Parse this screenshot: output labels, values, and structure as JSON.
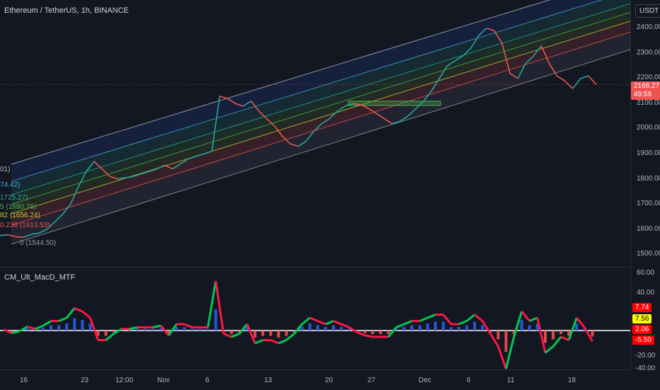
{
  "main": {
    "title": "Ethereum / TetherUS, 1h, BINANCE",
    "currency": "USDT",
    "last_price": "2166.27",
    "countdown": "49:59",
    "price_ticks": [
      "2400.00",
      "2300.00",
      "2200.00",
      "2100.00",
      "2000.00",
      "1900.00",
      "1800.00",
      "1700.00",
      "1600.00",
      "1500.00"
    ],
    "fib_labels": [
      {
        "text": "01)",
        "color": "#b2b5be"
      },
      {
        "text": "74.42)",
        "color": "#4aa3d8"
      },
      {
        "text": "1725.27)",
        "color": "#26a69a"
      },
      {
        "text": "5 (1690.76)",
        "color": "#4caf50"
      },
      {
        "text": "82 (1656.24)",
        "color": "#c0ca33"
      },
      {
        "text": "0.236 (1613.53)",
        "color": "#ef5350"
      },
      {
        "text": "0 (1544.50)",
        "color": "#9598a1"
      }
    ]
  },
  "indicator": {
    "title": "CM_Ult_MacD_MTF",
    "ticks": [
      "60.00",
      "40.00",
      "-20.00",
      "-40.00"
    ],
    "badges": [
      {
        "text": "7.74",
        "bg": "#ff0000",
        "fg": "#ffffff"
      },
      {
        "text": "7.56",
        "bg": "#ffff00",
        "fg": "#000000"
      },
      {
        "text": "2.06",
        "bg": "#ff0000",
        "fg": "#ffffff"
      },
      {
        "text": "-5.50",
        "bg": "#ff0000",
        "fg": "#ffffff"
      }
    ]
  },
  "time_axis": [
    "16",
    "23",
    "12:00",
    "Nov",
    "6",
    "13",
    "20",
    "27",
    "Dec",
    "6",
    "11",
    "18"
  ],
  "colors": {
    "background": "#131722",
    "up": "#26a69a",
    "down": "#ef5350",
    "macd_up": "#00c853",
    "macd_down": "#ff1744",
    "hist": "#2962ff"
  },
  "chart_data": {
    "type": "line",
    "ylim": [
      1460,
      2460
    ],
    "prices": [
      1565,
      1568,
      1560,
      1558,
      1570,
      1575,
      1590,
      1620,
      1650,
      1690,
      1760,
      1820,
      1860,
      1830,
      1800,
      1790,
      1795,
      1800,
      1810,
      1820,
      1830,
      1845,
      1830,
      1850,
      1870,
      1880,
      1890,
      1900,
      2120,
      2110,
      2090,
      2080,
      2100,
      2060,
      2030,
      2000,
      1960,
      1930,
      1920,
      1940,
      1980,
      2010,
      2030,
      2060,
      2080,
      2090,
      2085,
      2070,
      2050,
      2030,
      2010,
      2020,
      2040,
      2070,
      2100,
      2140,
      2190,
      2240,
      2260,
      2280,
      2310,
      2360,
      2390,
      2380,
      2330,
      2210,
      2190,
      2250,
      2280,
      2320,
      2250,
      2200,
      2180,
      2150,
      2190,
      2200,
      2166
    ]
  }
}
